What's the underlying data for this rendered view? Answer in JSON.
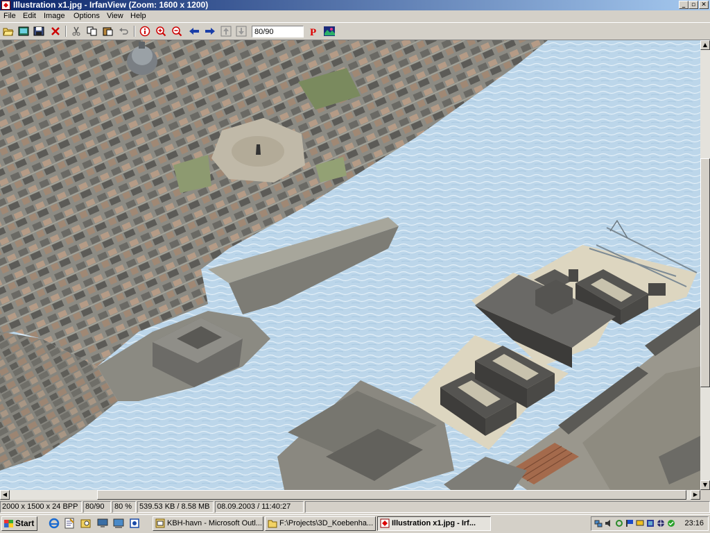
{
  "window": {
    "title": "Illustration x1.jpg - IrfanView (Zoom: 1600 x 1200)",
    "minimize_glyph": "_",
    "restore_glyph": "▫",
    "close_glyph": "✕"
  },
  "menu": [
    "File",
    "Edit",
    "Image",
    "Options",
    "View",
    "Help"
  ],
  "toolbar": {
    "buttons": [
      "open-icon",
      "slideshow-icon",
      "save-icon",
      "delete-icon",
      "cut-icon",
      "copy-icon",
      "paste-icon",
      "undo-icon",
      "info-icon",
      "zoom-in-icon",
      "zoom-out-icon",
      "previous-icon",
      "next-icon",
      "first-icon",
      "last-icon",
      "print-icon",
      "irfanview-icon"
    ],
    "page_field": "80/90"
  },
  "image": {
    "description_icon": "aerial-3d-harbour-city-image"
  },
  "statusbar": {
    "dimensions": "2000 x 1500 x 24 BPP",
    "page": "80/90",
    "zoom": "80 %",
    "size": "539.53 KB / 8.58 MB",
    "date": "08.09.2003 / 11:40:27"
  },
  "taskbar": {
    "start_label": "Start",
    "quick_launch": [
      "ie-icon",
      "notepad-icon",
      "search-icon",
      "desktop-icon",
      "outlook-icon"
    ],
    "tasks": [
      {
        "label": "KBH-havn - Microsoft Outl...",
        "icon": "outlook-icon",
        "active": false
      },
      {
        "label": "F:\\Projects\\3D_Koebenha...",
        "icon": "folder-icon",
        "active": false
      },
      {
        "label": "Illustration x1.jpg - Irf...",
        "icon": "irfanview-icon",
        "active": true
      }
    ],
    "clock": "23:16"
  },
  "colors": {
    "titlebar_start": "#0a246a",
    "titlebar_end": "#a6caf0",
    "water": "#bcd6ea",
    "chrome": "#d4d0c8"
  }
}
